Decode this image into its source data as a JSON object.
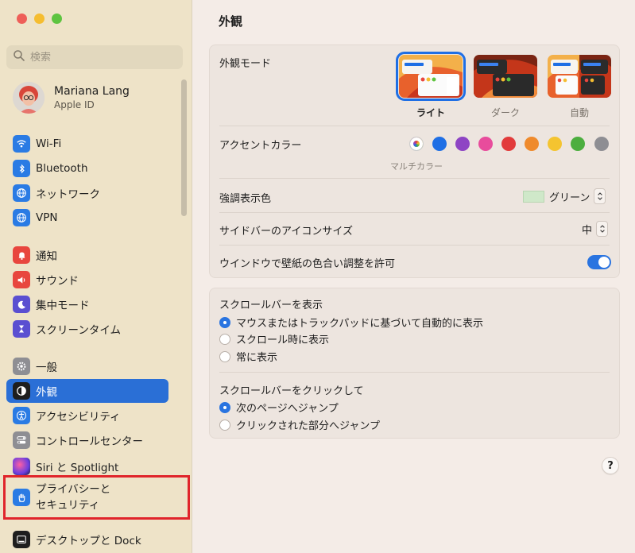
{
  "sidebar": {
    "search_placeholder": "検索",
    "account": {
      "name": "Mariana Lang",
      "subtitle": "Apple ID"
    },
    "items": [
      {
        "label": "Wi-Fi",
        "icon": "wifi-icon",
        "color": "#2a7be4"
      },
      {
        "label": "Bluetooth",
        "icon": "bluetooth-icon",
        "color": "#2a7be4"
      },
      {
        "label": "ネットワーク",
        "icon": "globe-icon",
        "color": "#2a7be4"
      },
      {
        "label": "VPN",
        "icon": "globe-icon",
        "color": "#2a7be4"
      },
      {
        "label": "通知",
        "icon": "bell-icon",
        "color": "#e8463e"
      },
      {
        "label": "サウンド",
        "icon": "speaker-icon",
        "color": "#e8463e"
      },
      {
        "label": "集中モード",
        "icon": "moon-icon",
        "color": "#5a4fd1"
      },
      {
        "label": "スクリーンタイム",
        "icon": "hourglass-icon",
        "color": "#5a4fd1"
      },
      {
        "label": "一般",
        "icon": "gear-icon",
        "color": "#8e8e93"
      },
      {
        "label": "外観",
        "icon": "appearance-icon",
        "color": "#1e1e1e"
      },
      {
        "label": "アクセシビリティ",
        "icon": "accessibility-icon",
        "color": "#2a7be4"
      },
      {
        "label": "コントロールセンター",
        "icon": "toggles-icon",
        "color": "#8e8e93"
      },
      {
        "label": "Siri と Spotlight",
        "icon": "siri-icon",
        "color": "#8a3fd1"
      },
      {
        "label": "プライバシーと\nセキュリティ",
        "icon": "hand-icon",
        "color": "#2a7be4"
      },
      {
        "label": "デスクトップと Dock",
        "icon": "dock-icon",
        "color": "#1e1e1e"
      }
    ],
    "selected_index": 9
  },
  "main": {
    "title": "外観",
    "appearance_mode": {
      "label": "外観モード",
      "options": [
        {
          "label": "ライト",
          "selected": true
        },
        {
          "label": "ダーク",
          "selected": false
        },
        {
          "label": "自動",
          "selected": false
        }
      ]
    },
    "accent_color": {
      "label": "アクセントカラー",
      "sublabel": "マルチカラー",
      "colors": [
        "multicolor",
        "#1f6fe5",
        "#8e44c4",
        "#e84c9c",
        "#e23b3b",
        "#ef8a2c",
        "#f4c430",
        "#4cae3f",
        "#8e8e93"
      ]
    },
    "highlight_color": {
      "label": "強調表示色",
      "value": "グリーン",
      "swatch": "#cfe8c9"
    },
    "sidebar_icon_size": {
      "label": "サイドバーのアイコンサイズ",
      "value": "中"
    },
    "wallpaper_tinting": {
      "label": "ウインドウで壁紙の色合い調整を許可",
      "enabled": true
    },
    "show_scrollbars": {
      "label": "スクロールバーを表示",
      "options": [
        {
          "label": "マウスまたはトラックパッドに基づいて自動的に表示",
          "selected": true
        },
        {
          "label": "スクロール時に表示",
          "selected": false
        },
        {
          "label": "常に表示",
          "selected": false
        }
      ]
    },
    "click_scrollbar": {
      "label": "スクロールバーをクリックして",
      "options": [
        {
          "label": "次のページへジャンプ",
          "selected": true
        },
        {
          "label": "クリックされた部分へジャンプ",
          "selected": false
        }
      ]
    },
    "help": "?"
  }
}
